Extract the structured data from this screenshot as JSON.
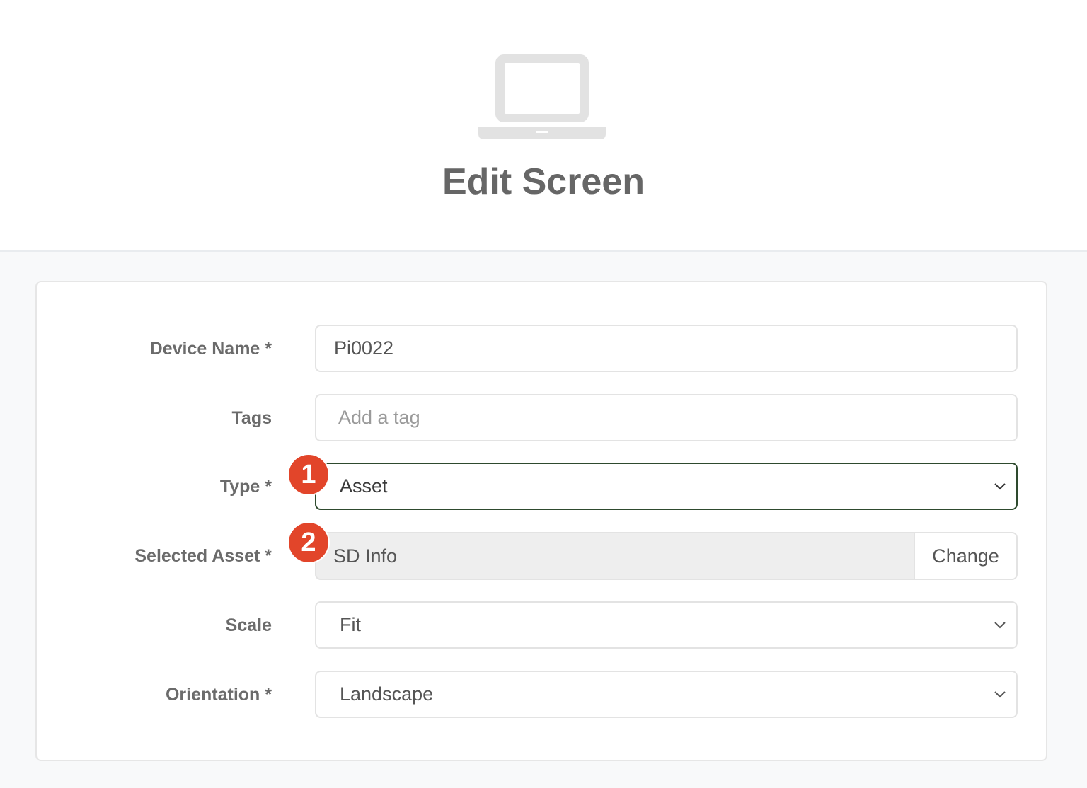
{
  "header": {
    "title": "Edit Screen",
    "icon": "laptop-icon"
  },
  "form": {
    "device_name": {
      "label": "Device Name *",
      "value": "Pi0022"
    },
    "tags": {
      "label": "Tags",
      "placeholder": "Add a tag"
    },
    "type": {
      "label": "Type *",
      "value": "Asset"
    },
    "selected_asset": {
      "label": "Selected Asset *",
      "value": "SD Info",
      "change_label": "Change"
    },
    "scale": {
      "label": "Scale",
      "value": "Fit"
    },
    "orientation": {
      "label": "Orientation *",
      "value": "Landscape"
    }
  },
  "annotations": {
    "step1": "1",
    "step2": "2"
  },
  "colors": {
    "badge": "#e2452a",
    "focus_border": "#2e4a2e",
    "title": "#666666"
  }
}
